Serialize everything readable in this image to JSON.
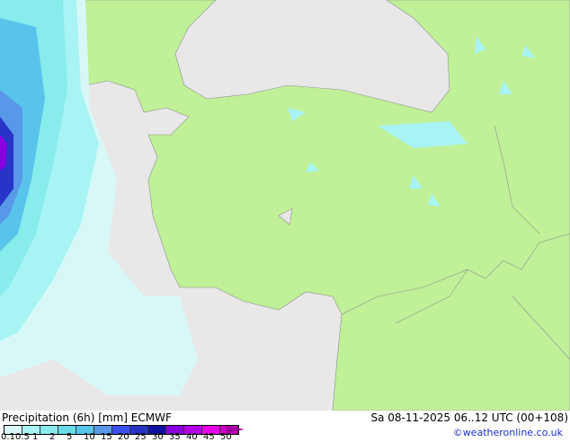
{
  "title": "Precipitation (6h) [mm] ECMWF",
  "valid_time": "Sa 08-11-2025 06..12 UTC (00+108)",
  "credit": "©weatheronline.co.uk",
  "legend": {
    "ticks": [
      "0.1",
      "0.5",
      "1",
      "2",
      "5",
      "10",
      "15",
      "20",
      "25",
      "30",
      "35",
      "40",
      "45",
      "50"
    ],
    "colors": [
      "#d8f8f8",
      "#a8f4f4",
      "#88ecec",
      "#68dce8",
      "#58c4ec",
      "#5898e8",
      "#3c50f0",
      "#2834c8",
      "#1010a0",
      "#8800e0",
      "#b400e8",
      "#e800e8",
      "#c800c0",
      "#a000a0"
    ]
  },
  "colors": {
    "sea": "#e8e8e8",
    "land": "#c0f098",
    "border": "#a0a0a0"
  }
}
